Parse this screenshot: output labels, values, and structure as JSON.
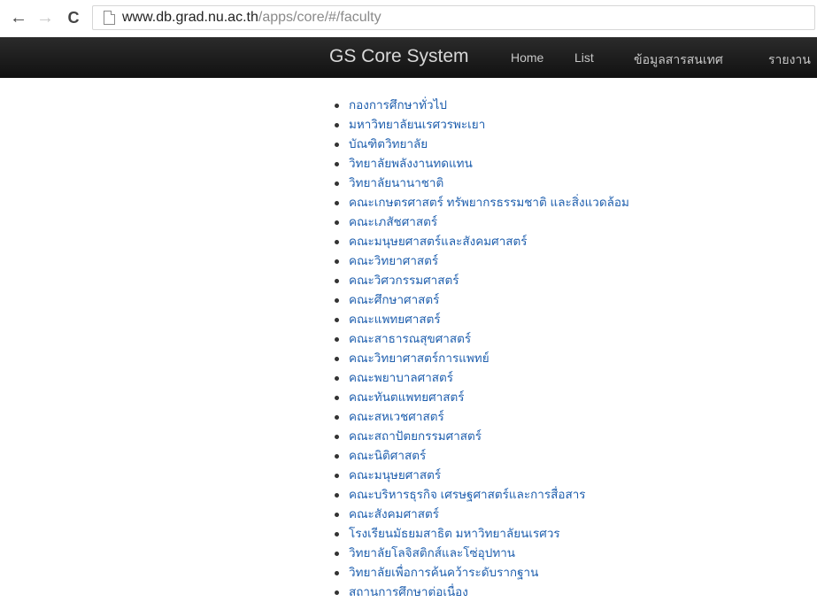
{
  "browser": {
    "back_icon": "←",
    "forward_icon": "→",
    "reload_icon": "C",
    "url_host": "www.db.grad.nu.ac.th",
    "url_path": "/apps/core/#/faculty"
  },
  "navbar": {
    "brand": "GS Core System",
    "links": [
      "Home",
      "List",
      "ข้อมูลสารสนเทศ",
      "รายงาน"
    ]
  },
  "faculties": [
    "กองการศึกษาทั่วไป",
    "มหาวิทยาลัยนเรศวรพะเยา",
    "บัณฑิตวิทยาลัย",
    "วิทยาลัยพลังงานทดแทน",
    "วิทยาลัยนานาชาติ",
    "คณะเกษตรศาสตร์ ทรัพยากรธรรมชาติ และสิ่งแวดล้อม",
    "คณะเภสัชศาสตร์",
    "คณะมนุษยศาสตร์และสังคมศาสตร์",
    "คณะวิทยาศาสตร์",
    "คณะวิศวกรรมศาสตร์",
    "คณะศึกษาศาสตร์",
    "คณะแพทยศาสตร์",
    "คณะสาธารณสุขศาสตร์",
    "คณะวิทยาศาสตร์การแพทย์",
    "คณะพยาบาลศาสตร์",
    "คณะทันตแพทยศาสตร์",
    "คณะสหเวชศาสตร์",
    "คณะสถาปัตยกรรมศาสตร์",
    "คณะนิติศาสตร์",
    "คณะมนุษยศาสตร์",
    "คณะบริหารธุรกิจ เศรษฐศาสตร์และการสื่อสาร",
    "คณะสังคมศาสตร์",
    "โรงเรียนมัธยมสาธิต มหาวิทยาลัยนเรศวร",
    "วิทยาลัยโลจิสติกส์และโซ่อุปทาน",
    "วิทยาลัยเพื่อการค้นคว้าระดับรากฐาน",
    "สถานการศึกษาต่อเนื่อง"
  ]
}
